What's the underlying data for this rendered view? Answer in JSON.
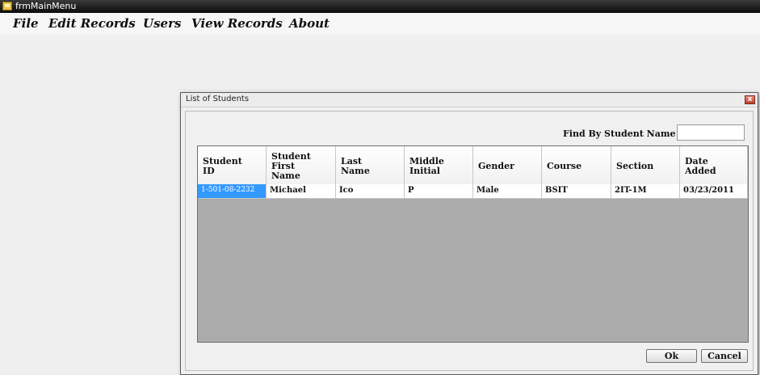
{
  "window": {
    "title": "frmMainMenu",
    "icon": "form-icon"
  },
  "menu": [
    {
      "label": "File"
    },
    {
      "label": "Edit Records"
    },
    {
      "label": "Users"
    },
    {
      "label": "View Records"
    },
    {
      "label": "About"
    }
  ],
  "dialog": {
    "title": "List of Students",
    "close_icon": "close-icon",
    "close_glyph": "x",
    "find_label": "Find By Student Name",
    "find_value": "",
    "columns": [
      [
        "Student",
        "ID"
      ],
      [
        "Student",
        "First",
        "Name"
      ],
      [
        "Last",
        "Name"
      ],
      [
        "Middle",
        "Initial"
      ],
      [
        "Gender"
      ],
      [
        "Course"
      ],
      [
        "Section"
      ],
      [
        "Date",
        "Added"
      ]
    ],
    "rows": [
      [
        "1-501-08-2232",
        "Michael",
        "Ico",
        "P",
        "Male",
        "BSIT",
        "2IT-1M",
        "03/23/2011"
      ]
    ],
    "ok_label": "Ok",
    "cancel_label": "Cancel"
  },
  "colors": {
    "selection": "#3399ff",
    "grid_background": "#ababab"
  }
}
